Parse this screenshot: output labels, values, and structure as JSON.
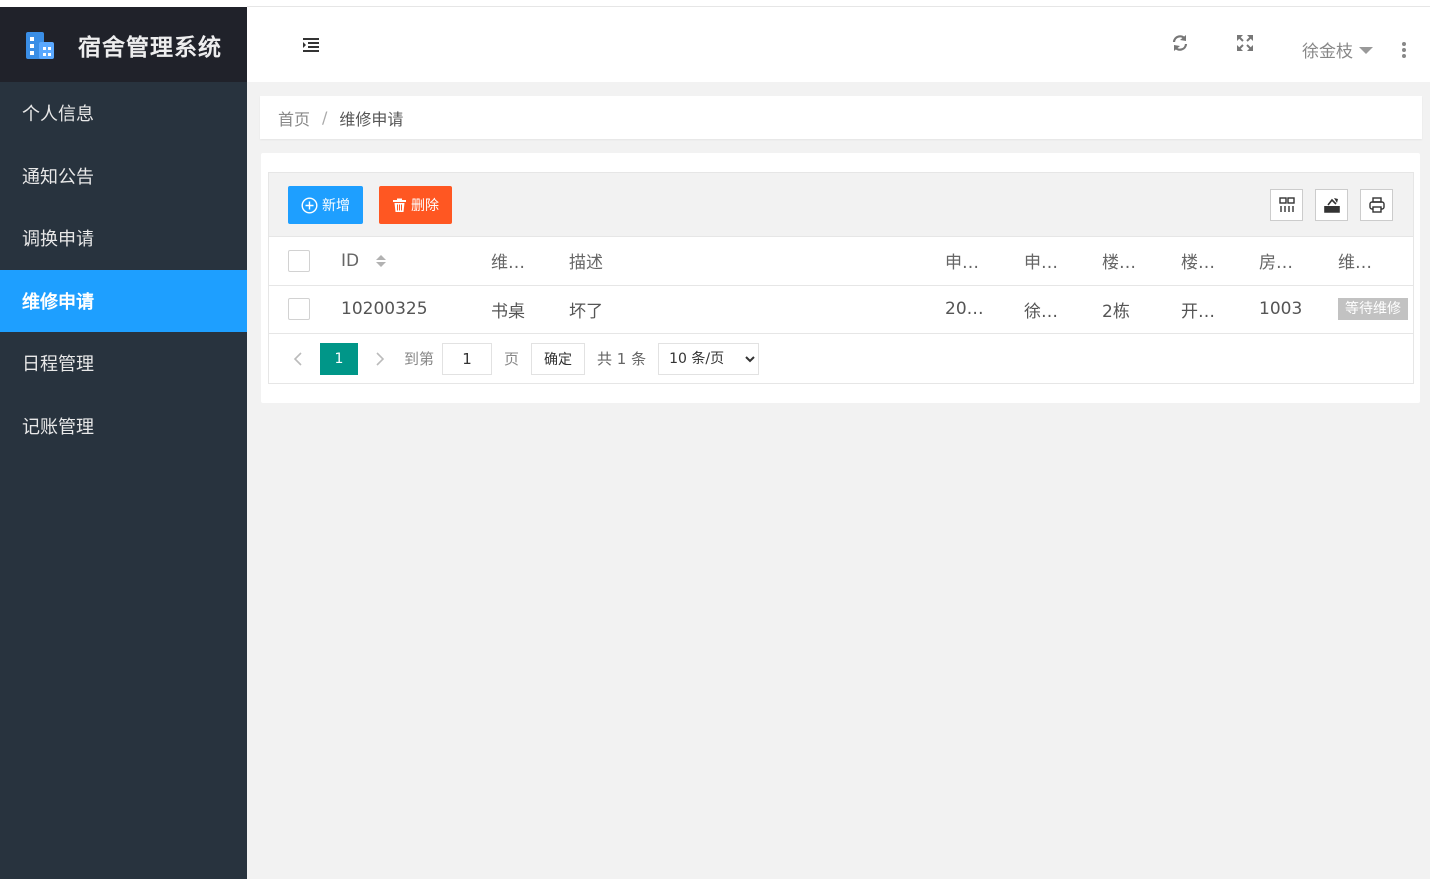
{
  "app": {
    "title": "宿舍管理系统",
    "icon": "building-icon"
  },
  "sidebar": {
    "items": [
      {
        "label": "个人信息",
        "active": false
      },
      {
        "label": "通知公告",
        "active": false
      },
      {
        "label": "调换申请",
        "active": false
      },
      {
        "label": "维修申请",
        "active": true
      },
      {
        "label": "日程管理",
        "active": false
      },
      {
        "label": "记账管理",
        "active": false
      }
    ]
  },
  "header": {
    "user_name": "徐金枝",
    "icons": [
      "menu-fold-icon",
      "refresh-icon",
      "fullscreen-icon",
      "more-icon"
    ]
  },
  "breadcrumb": {
    "home": "首页",
    "separator": "/",
    "current": "维修申请"
  },
  "toolbar": {
    "add_label": "新增",
    "delete_label": "删除",
    "icons": [
      "columns-icon",
      "export-icon",
      "print-icon"
    ]
  },
  "table": {
    "columns": [
      "ID",
      "维…",
      "描述",
      "申…",
      "申…",
      "楼…",
      "楼…",
      "房…",
      "维…"
    ],
    "rows": [
      {
        "id": "10200325",
        "item": "书桌",
        "desc": "坏了",
        "apply_time": "20…",
        "applicant": "徐…",
        "building": "2栋",
        "building2": "开…",
        "room": "1003",
        "status": "等待维修"
      }
    ]
  },
  "pager": {
    "current_page": "1",
    "goto_label": "到第",
    "page_input": "1",
    "page_unit": "页",
    "confirm_label": "确定",
    "total_label": "共 1 条",
    "page_size": "10 条/页",
    "page_size_options": [
      "10 条/页"
    ]
  },
  "colors": {
    "sidebar_bg": "#28333e",
    "logo_bg": "#20222a",
    "active": "#1e9fff",
    "danger": "#ff5722",
    "pager_active": "#009688"
  }
}
